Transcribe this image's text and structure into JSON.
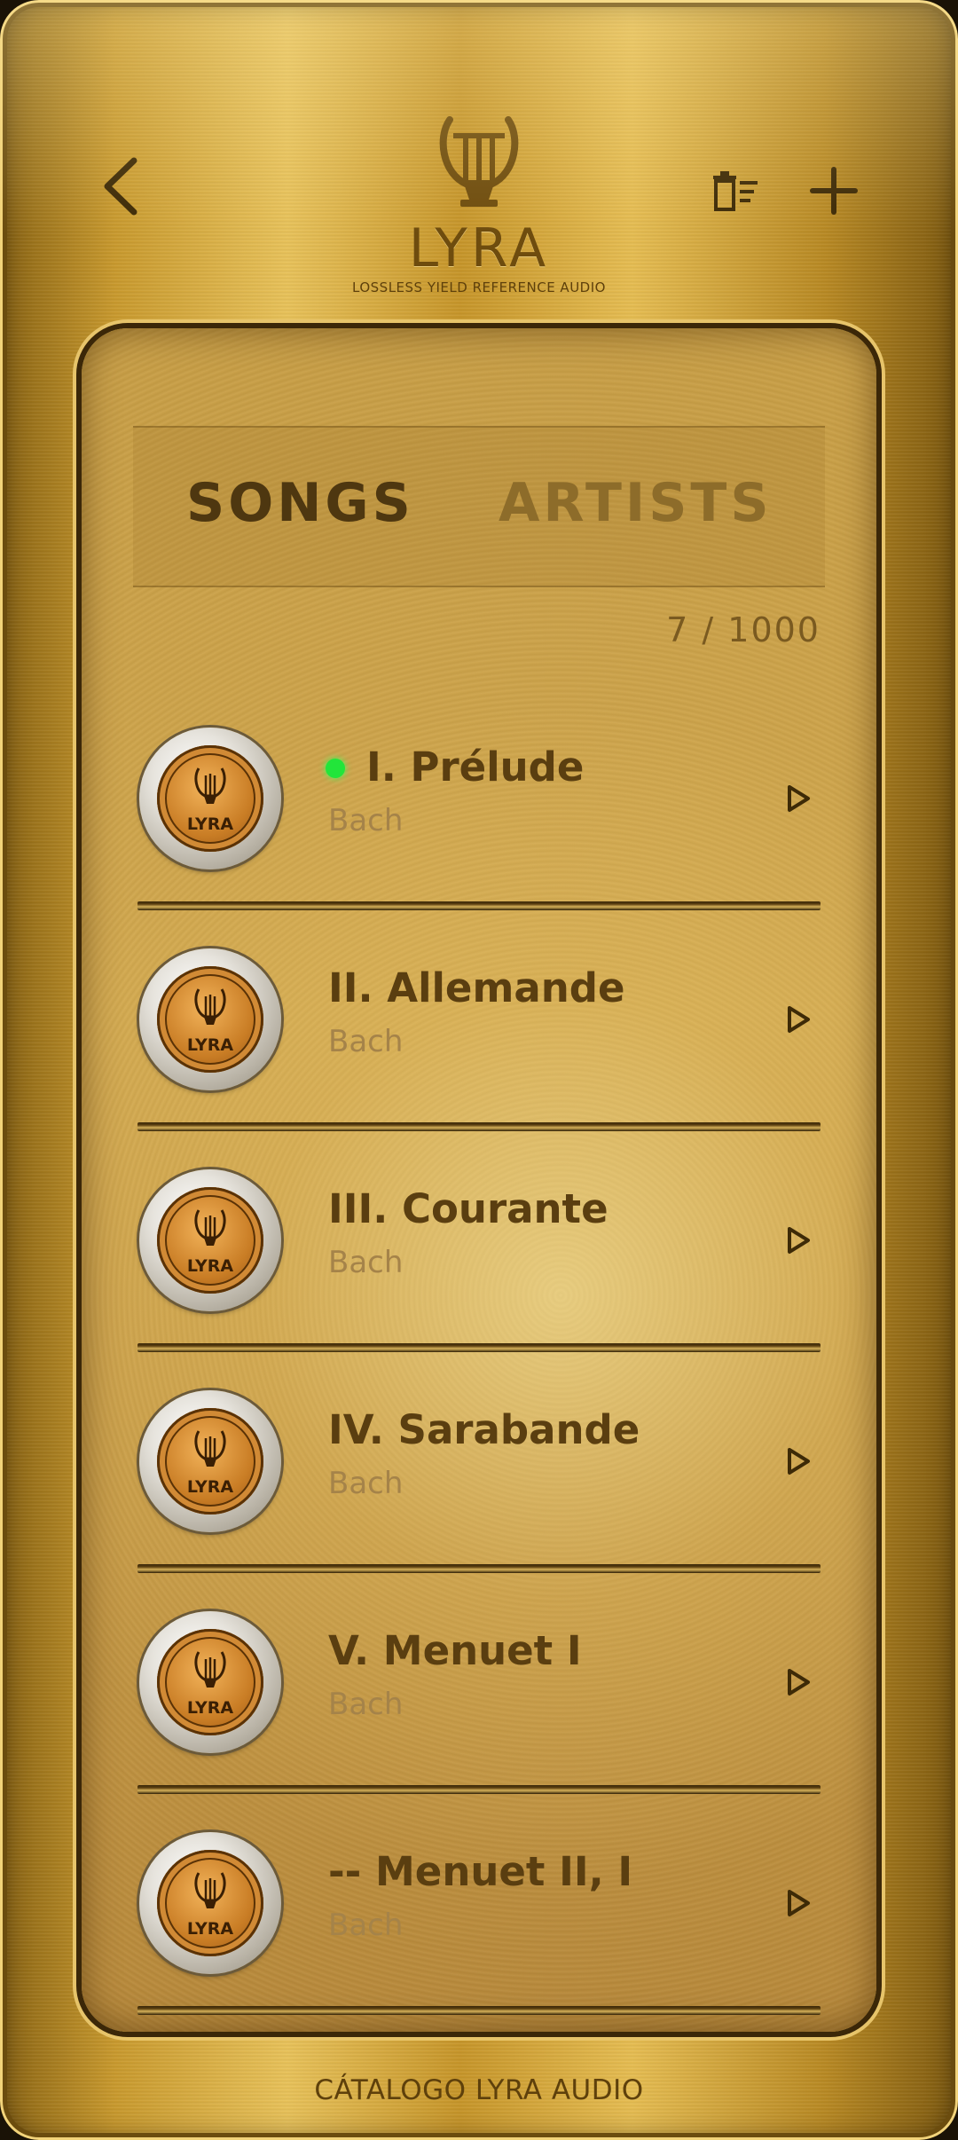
{
  "header": {
    "back_icon": "chevron-left-icon",
    "delete_icon": "delete-list-icon",
    "add_icon": "plus-icon",
    "logo": {
      "icon": "lyre-icon",
      "name": "LYRA",
      "tagline": "LOSSLESS YIELD REFERENCE AUDIO"
    }
  },
  "tabs": [
    {
      "label": "SONGS",
      "active": true
    },
    {
      "label": "ARTISTS",
      "active": false
    }
  ],
  "track_count": "7 / 1000",
  "songs": [
    {
      "title": "I. Prélude",
      "artist": "Bach",
      "playing": true,
      "cover": "LYRA"
    },
    {
      "title": "II. Allemande",
      "artist": "Bach",
      "playing": false,
      "cover": "LYRA"
    },
    {
      "title": "III. Courante",
      "artist": "Bach",
      "playing": false,
      "cover": "LYRA"
    },
    {
      "title": "IV. Sarabande",
      "artist": "Bach",
      "playing": false,
      "cover": "LYRA"
    },
    {
      "title": "V. Menuet I",
      "artist": "Bach",
      "playing": false,
      "cover": "LYRA"
    },
    {
      "title": "-- Menuet II, I",
      "artist": "Bach",
      "playing": false,
      "cover": "LYRA"
    }
  ],
  "footer": "CÁTALOGO LYRA AUDIO",
  "colors": {
    "gold_light": "#e8c25a",
    "gold_dark": "#6e4c0e",
    "text_dark": "#5a3e10",
    "playing_indicator": "#22e53a"
  }
}
